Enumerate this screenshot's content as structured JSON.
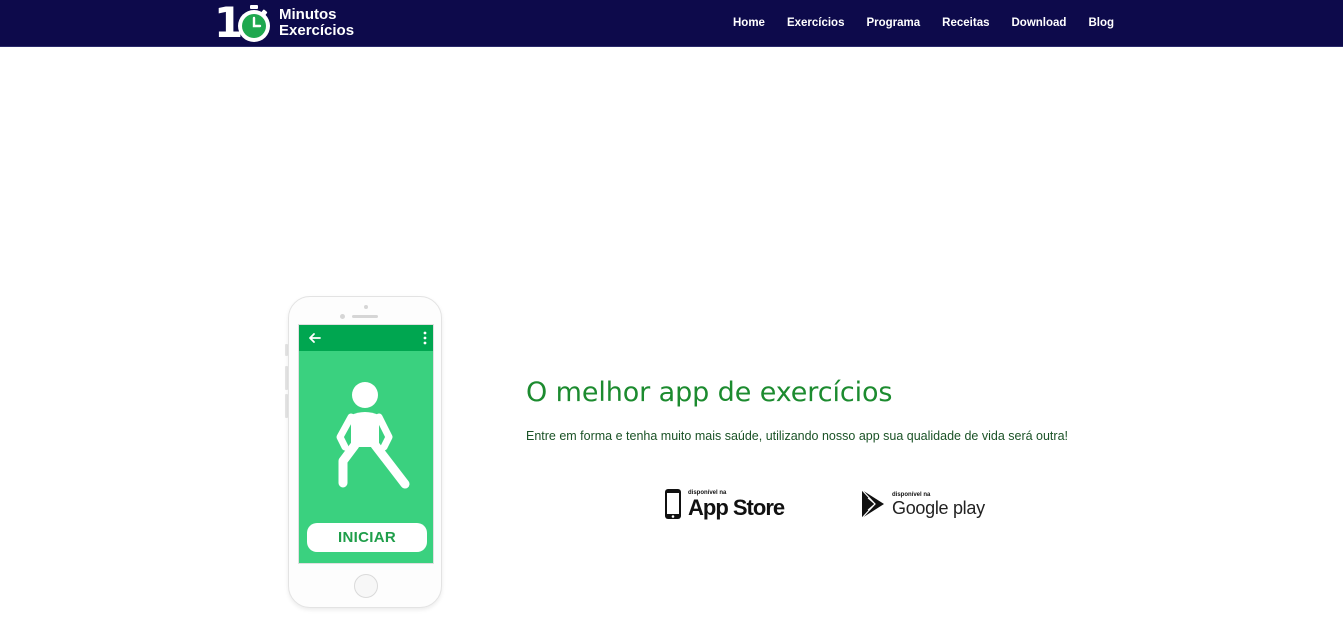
{
  "header": {
    "logo": {
      "number": "1",
      "line1": "Minutos",
      "line2": "Exercícios"
    },
    "nav": [
      {
        "label": "Home"
      },
      {
        "label": "Exercícios"
      },
      {
        "label": "Programa"
      },
      {
        "label": "Receitas"
      },
      {
        "label": "Download"
      },
      {
        "label": "Blog"
      }
    ]
  },
  "phone": {
    "start_button": "INICIAR"
  },
  "main": {
    "headline": "O melhor app de exercícios",
    "subtitle": "Entre em forma e tenha muito mais saúde, utilizando nosso app sua qualidade de vida será outra!"
  },
  "stores": {
    "apple": {
      "small": "disponível na",
      "big": "App Store"
    },
    "google": {
      "small": "disponível na",
      "big": "Google play"
    }
  },
  "colors": {
    "navbar": "#0d0a4b",
    "headline": "#1c8b2f",
    "phone_screen": "#3ad17f",
    "app_bar": "#00a650"
  }
}
